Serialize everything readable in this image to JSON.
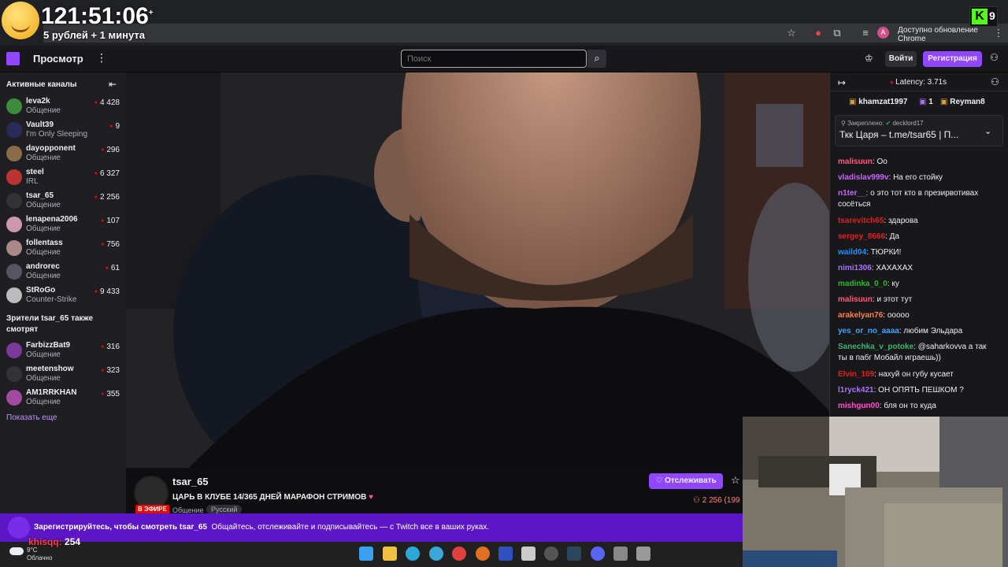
{
  "overlay": {
    "timer": "121:51:06",
    "timer_plus": "+",
    "timer_sub": "5 рублей + 1 минута",
    "kick_viewers": "9",
    "kick_donor": "khisqq:",
    "kick_donor_amount": "254"
  },
  "browser": {
    "update_button": "Доступно обновление Chrome",
    "profile_initial": "A"
  },
  "nav": {
    "browse_label": "Просмотр",
    "search_placeholder": "Поиск",
    "login_label": "Войти",
    "register_label": "Регистрация"
  },
  "sidebar": {
    "active_heading": "Активные каналы",
    "channels": [
      {
        "name": "leva2k",
        "game": "Общение",
        "viewers": "4 428",
        "color": "#3b8c3b"
      },
      {
        "name": "Vault39",
        "game": "I'm Only Sleeping",
        "viewers": "9",
        "color": "#2a2a5a"
      },
      {
        "name": "dayopponent",
        "game": "Общение",
        "viewers": "296",
        "color": "#8a6b4a"
      },
      {
        "name": "steel",
        "game": "IRL",
        "viewers": "6 327",
        "color": "#b33"
      },
      {
        "name": "tsar_65",
        "game": "Общение",
        "viewers": "2 256",
        "color": "#333"
      },
      {
        "name": "lenapena2006",
        "game": "Общение",
        "viewers": "107",
        "color": "#c9a"
      },
      {
        "name": "follentass",
        "game": "Общение",
        "viewers": "756",
        "color": "#a88"
      },
      {
        "name": "androrec",
        "game": "Общение",
        "viewers": "61",
        "color": "#556"
      },
      {
        "name": "StRoGo",
        "game": "Counter-Strike",
        "viewers": "9 433",
        "color": "#bbb"
      }
    ],
    "also_heading": "Зрители tsar_65 также смотрят",
    "also": [
      {
        "name": "FarbizzBat9",
        "game": "Общение",
        "viewers": "316",
        "color": "#7a3a9a"
      },
      {
        "name": "meetenshow",
        "game": "Общение",
        "viewers": "323",
        "color": "#333"
      },
      {
        "name": "AM1RRKHAN",
        "game": "Общение",
        "viewers": "355",
        "color": "#a04aa0"
      }
    ],
    "show_more": "Показать еще"
  },
  "stream": {
    "channel": "tsar_65",
    "live": "В ЭФИРЕ",
    "title": "ЦАРЬ В КЛУБЕ 14/365 ДНЕЙ МАРАФОН СТРИМОВ",
    "category": "Общение",
    "tag": "Русский",
    "follow_label": "Отслеживать",
    "viewers": "2 256 (199"
  },
  "chat": {
    "latency": "Latency: 3.71s",
    "gifters": [
      {
        "name": "khamzat1997",
        "count": "1"
      },
      {
        "name": "Reyman8",
        "count": ""
      }
    ],
    "pinned_label": "Закреплено:",
    "pinned_by": "decklord17",
    "pinned_text": "Ткк Царя – t.me/tsar65 | П...",
    "messages": [
      {
        "user": "malisuun",
        "text": "Оо",
        "color": "#ff5a7a"
      },
      {
        "user": "vladislav999v",
        "text": "На его стойку",
        "color": "#c864ff"
      },
      {
        "user": "n1ter__",
        "text": "о это тот кто в презирвотивах сосёться",
        "color": "#c864ff"
      },
      {
        "user": "tsarevitch65",
        "text": "здарова",
        "color": "#e02020"
      },
      {
        "user": "sergey_8666",
        "text": "Да",
        "color": "#e02020"
      },
      {
        "user": "waild04",
        "text": "ТЮРКИ!",
        "color": "#1e90ff"
      },
      {
        "user": "nimi1306",
        "text": "ХАХАХАХ",
        "color": "#a970ff"
      },
      {
        "user": "madinka_0_0",
        "text": "ку",
        "color": "#2eb82e"
      },
      {
        "user": "malisuun",
        "text": "и этот тут",
        "color": "#ff5a7a"
      },
      {
        "user": "arakelyan76",
        "text": "ооооо",
        "color": "#ff7f50"
      },
      {
        "user": "yes_or_no_aaaa",
        "text": "любим Эльдара",
        "color": "#3da5ff"
      },
      {
        "user": "Sanechka_v_potoke",
        "text": "@saharkovva а так ты в пабг Мобайл играешь))",
        "color": "#3cb371"
      },
      {
        "user": "Elvin_109",
        "text": "нахуй он губу кусает",
        "color": "#e02020"
      },
      {
        "user": "l1ryck421",
        "text": "ОН ОПЯТЬ ПЕШКОМ ?",
        "color": "#a970ff"
      },
      {
        "user": "mishgun00",
        "text": "бля он то куда",
        "color": "#ff4fc8"
      }
    ]
  },
  "banner": {
    "bold": "Зарегистрируйтесь, чтобы смотреть tsar_65",
    "text": "Общайтесь, отслеживайте и подписывайтесь — с Twitch все в ваших руках."
  },
  "taskbar": {
    "temp": "9°C",
    "weather": "Облачно"
  }
}
